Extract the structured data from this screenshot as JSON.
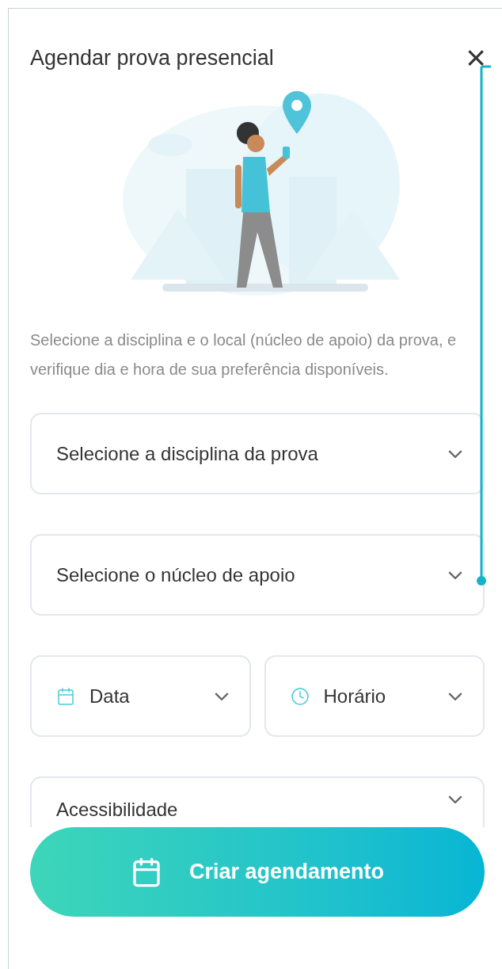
{
  "title": "Agendar prova presencial",
  "close_button": {
    "label": "×"
  },
  "description": "Selecione a disciplina e o local (núcleo de apoio) da prova, e verifique dia e hora de sua preferência disponíveis.",
  "selects": [
    {
      "kind": "full",
      "placeholder": "Selecione a disciplina da prova"
    },
    {
      "kind": "full",
      "placeholder": "Selecione o núcleo de apoio"
    },
    {
      "kind": "date",
      "placeholder": "Data"
    },
    {
      "kind": "time",
      "placeholder": "Horário"
    },
    {
      "kind": "full",
      "placeholder": "Acessibilidade"
    }
  ],
  "submit_button": {
    "label": "Criar agendamento"
  }
}
